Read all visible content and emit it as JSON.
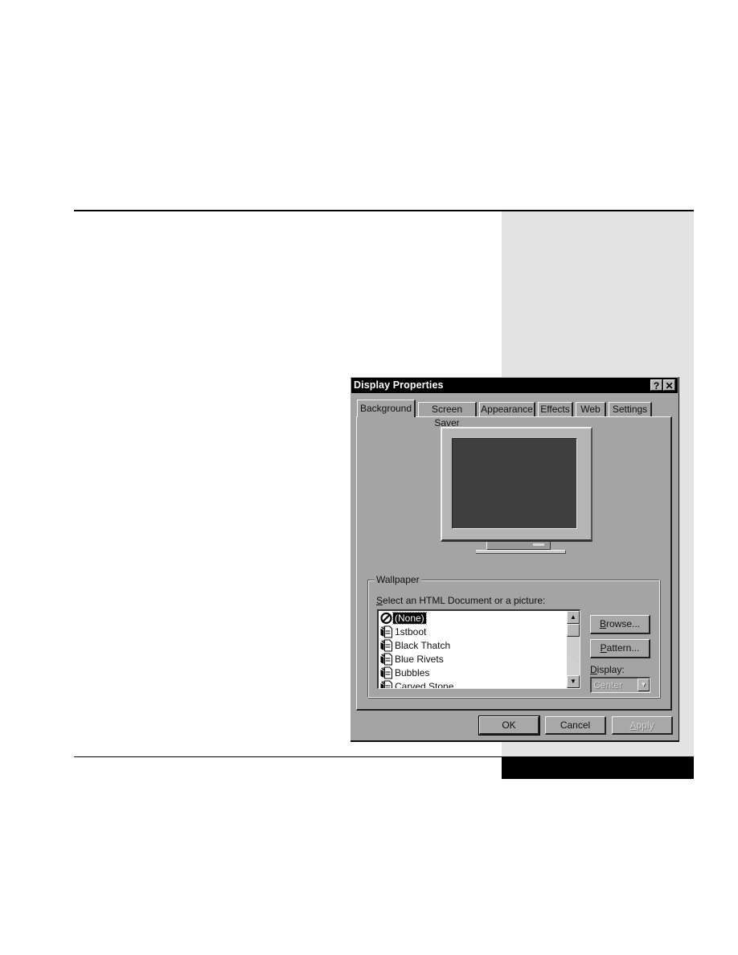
{
  "dialog": {
    "title": "Display Properties",
    "help_button": "?",
    "close_button": "✕",
    "tabs": [
      {
        "label": "Background",
        "active": true
      },
      {
        "label": "Screen Saver",
        "active": false
      },
      {
        "label": "Appearance",
        "active": false
      },
      {
        "label": "Effects",
        "active": false
      },
      {
        "label": "Web",
        "active": false
      },
      {
        "label": "Settings",
        "active": false
      }
    ],
    "wallpaper": {
      "group_label": "Wallpaper",
      "prompt_prefix": "S",
      "prompt_rest": "elect an HTML Document or a picture:",
      "items": [
        {
          "label": "(None)",
          "icon": "no-symbol-icon",
          "selected": true
        },
        {
          "label": "1stboot",
          "icon": "bitmap-file-icon",
          "selected": false
        },
        {
          "label": "Black Thatch",
          "icon": "bitmap-file-icon",
          "selected": false
        },
        {
          "label": "Blue Rivets",
          "icon": "bitmap-file-icon",
          "selected": false
        },
        {
          "label": "Bubbles",
          "icon": "bitmap-file-icon",
          "selected": false
        },
        {
          "label": "Carved Stone",
          "icon": "bitmap-file-icon",
          "selected": false
        }
      ],
      "scroll_up": "▲",
      "scroll_down": "▼",
      "browse": {
        "accel": "B",
        "rest": "rowse..."
      },
      "pattern": {
        "accel": "P",
        "rest": "attern..."
      },
      "display_label": {
        "accel": "D",
        "rest": "isplay:"
      },
      "display_value": "Center",
      "dropdown_arrow": "▼"
    },
    "buttons": {
      "ok": "OK",
      "cancel": "Cancel",
      "apply_accel": "A",
      "apply_rest": "pply"
    }
  }
}
